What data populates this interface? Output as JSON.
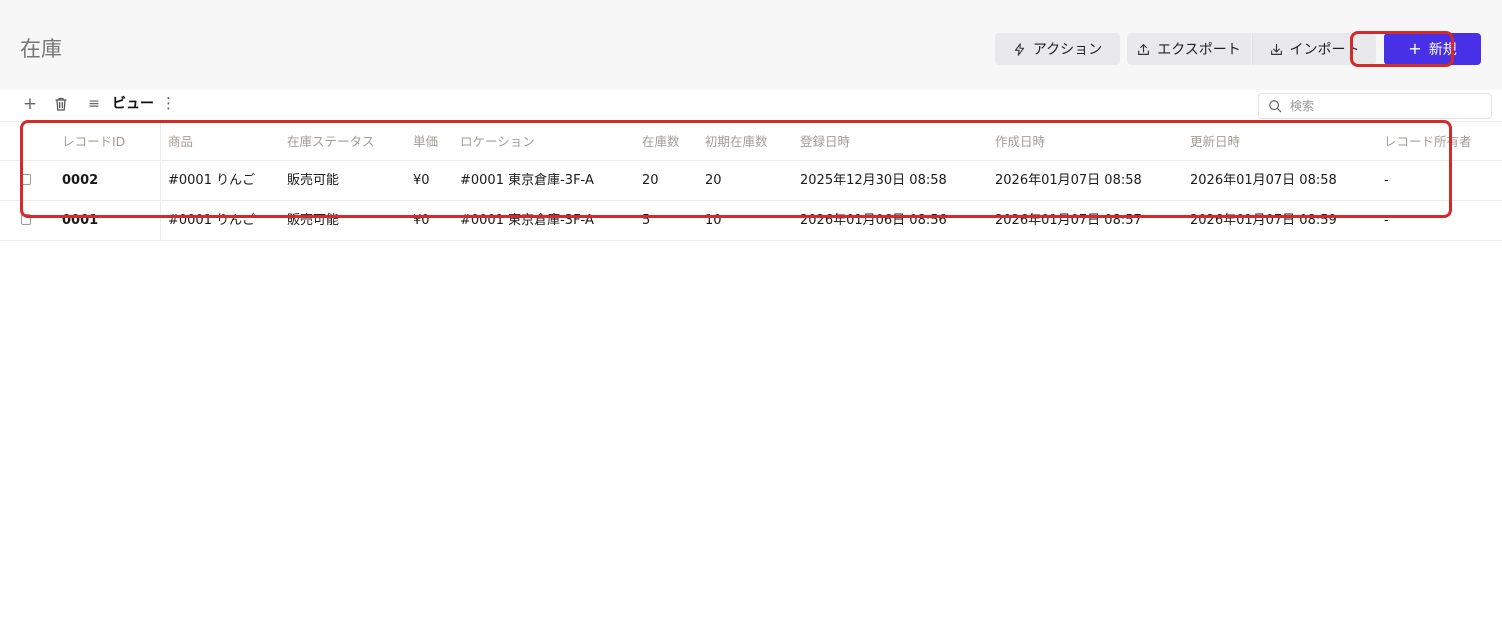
{
  "page": {
    "title": "在庫"
  },
  "header_actions": {
    "action_label": "アクション",
    "export_label": "エクスポート",
    "import_label": "インポート",
    "new_label": "新規",
    "new_button_color": "#4830e6"
  },
  "toolbar": {
    "view_label": "ビュー",
    "search_placeholder": "検索",
    "icons": [
      "plus-icon",
      "trash-icon",
      "list-icon",
      "kebab-icon",
      "search-icon"
    ]
  },
  "table": {
    "columns": [
      "レコードID",
      "商品",
      "在庫ステータス",
      "単価",
      "ロケーション",
      "在庫数",
      "初期在庫数",
      "登録日時",
      "作成日時",
      "更新日時",
      "レコード所有者"
    ],
    "rows": [
      {
        "record_id": "0002",
        "product": "#0001 りんご",
        "status": "販売可能",
        "price": "¥0",
        "location": "#0001 東京倉庫-3F-A",
        "stock": "20",
        "initial_stock": "20",
        "registered_at": "2025年12月30日 08:58",
        "created_at": "2026年01月07日 08:58",
        "updated_at": "2026年01月07日 08:58",
        "owner": "-"
      },
      {
        "record_id": "0001",
        "product": "#0001 りんご",
        "status": "販売可能",
        "price": "¥0",
        "location": "#0001 東京倉庫-3F-A",
        "stock": "5",
        "initial_stock": "10",
        "registered_at": "2026年01月06日 08:56",
        "created_at": "2026年01月07日 08:57",
        "updated_at": "2026年01月07日 08:59",
        "owner": "-"
      }
    ]
  },
  "annotation_color": "#d42a2a"
}
